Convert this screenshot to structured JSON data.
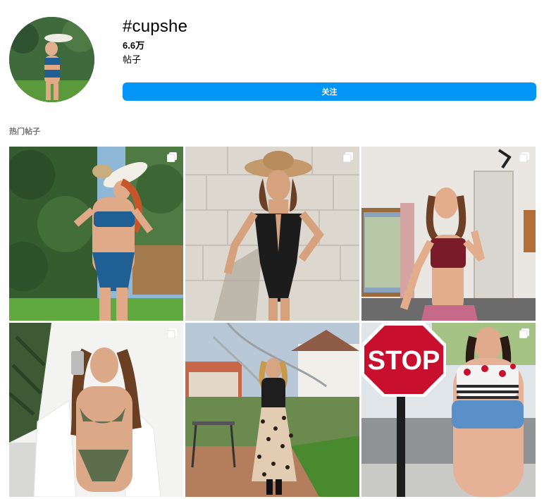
{
  "hashtag": {
    "title": "#cupshe",
    "post_count": "6.6万",
    "post_label": "帖子",
    "follow_label": "关注"
  },
  "top_posts": {
    "heading": "热门帖子",
    "posts": [
      {
        "description": "woman in blue bikini and straw hat by hedge",
        "multi": true
      },
      {
        "description": "woman in black one-piece swimsuit and brown hat by white brick wall",
        "multi": true
      },
      {
        "description": "woman in burgundy bikini top indoors by window",
        "multi": true
      },
      {
        "description": "woman in olive green bikini with white shirt taking mirror selfie",
        "multi": true
      },
      {
        "description": "woman in black top and leopard print skirt in garden",
        "multi": false
      },
      {
        "description": "woman in halter swimsuit and denim shorts by stop sign",
        "multi": true
      }
    ],
    "stop_sign_text": "STOP"
  },
  "colors": {
    "accent": "#0095f6",
    "muted_text": "#737373"
  },
  "icons": {
    "multi_post": "carousel-icon"
  }
}
